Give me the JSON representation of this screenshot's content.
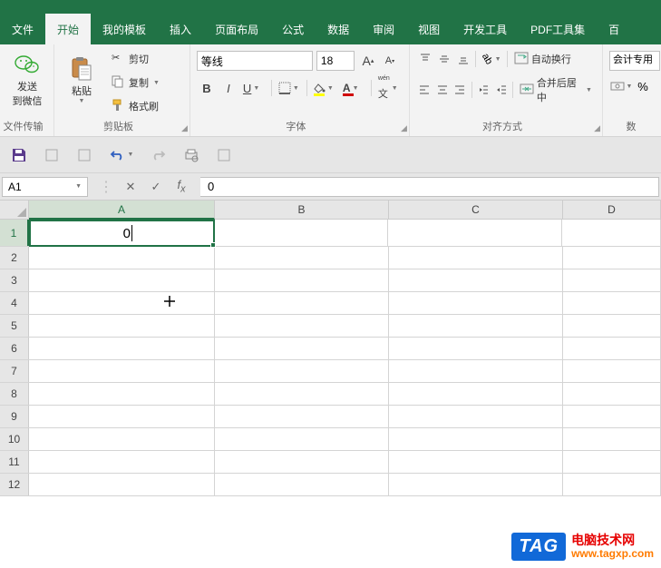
{
  "menu": {
    "tabs": [
      "文件",
      "开始",
      "我的模板",
      "插入",
      "页面布局",
      "公式",
      "数据",
      "审阅",
      "视图",
      "开发工具",
      "PDF工具集",
      "百"
    ],
    "active": 1
  },
  "ribbon": {
    "send": {
      "line1": "发送",
      "line2": "到微信"
    },
    "file_transfer": "文件传输",
    "paste": "粘贴",
    "cut": "剪切",
    "copy": "复制",
    "format_painter": "格式刷",
    "clipboard_label": "剪贴板",
    "font_name": "等线",
    "font_size": "18",
    "font_label": "字体",
    "align_wrap": "自动换行",
    "merge_center": "合并后居中",
    "align_label": "对齐方式",
    "numfmt": "会计专用",
    "num_label": "数"
  },
  "formula_bar": {
    "namebox": "A1",
    "value": "0"
  },
  "sheet": {
    "columns": [
      "A",
      "B",
      "C",
      "D"
    ],
    "rows": [
      "1",
      "2",
      "3",
      "4",
      "5",
      "6",
      "7",
      "8",
      "9",
      "10",
      "11",
      "12"
    ],
    "active_cell_value": "0"
  },
  "watermark": {
    "tag": "TAG",
    "cn": "电脑技术网",
    "url": "www.tagxp.com"
  }
}
